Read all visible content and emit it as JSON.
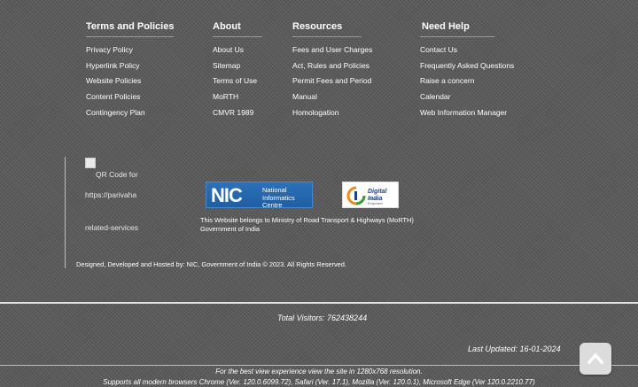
{
  "footer_links": {
    "columns": [
      {
        "heading": "Terms and Policies",
        "items": [
          "Privacy Policy",
          "Hyperlink Policy",
          "Website Policies",
          "Content Policies",
          "Contingency Plan"
        ]
      },
      {
        "heading": "About",
        "items": [
          "About Us",
          "Sitemap",
          "Terms of Use",
          "MoRTH",
          "CMVR 1989"
        ]
      },
      {
        "heading": "Resources",
        "items": [
          "Fees and User Charges",
          "Act, Rules and Policies",
          "Permit Fees and Period",
          "Manual",
          "Homologation"
        ]
      },
      {
        "heading": "Need Help",
        "items": [
          "Contact Us",
          "Frequently Asked Questions",
          "Raise a concern",
          "Calendar",
          "Web Information Manager"
        ]
      }
    ]
  },
  "qr": {
    "alt_lines": [
      "QR Code for",
      "https://parivaha",
      "related-services"
    ]
  },
  "logos": {
    "nic_mark": "NIC",
    "nic_line1": "National",
    "nic_line2": "Informatics",
    "nic_line3": "Centre",
    "digital_india": "Digital India",
    "digital_india_sub": "Power To Empower"
  },
  "belongs": {
    "line1": "This Website belongs to Ministry of Road Transport & Highways (MoRTH)",
    "line2": "Government of India"
  },
  "designed_by": "Designed, Developed and Hosted by: NIC, Government of India © 2023. All Rights Reserved.",
  "visitors": "Total Visitors: 762438244",
  "last_updated": "Last Updated: 16-01-2024",
  "best_view": "For the best view experience view the site in 1280x768 resolution.",
  "supports": "Supports all modern browsers Chrome (Ver. 120.0.6099.72), Safari (Ver. 17.1), Mozilla (Ver. 120.0.1), Microsoft Edge (Ver 120.0.2210.77)",
  "colors": {
    "background": "#5c5c5c",
    "nic_blue": "#2d71b8",
    "text": "#ffffff"
  }
}
